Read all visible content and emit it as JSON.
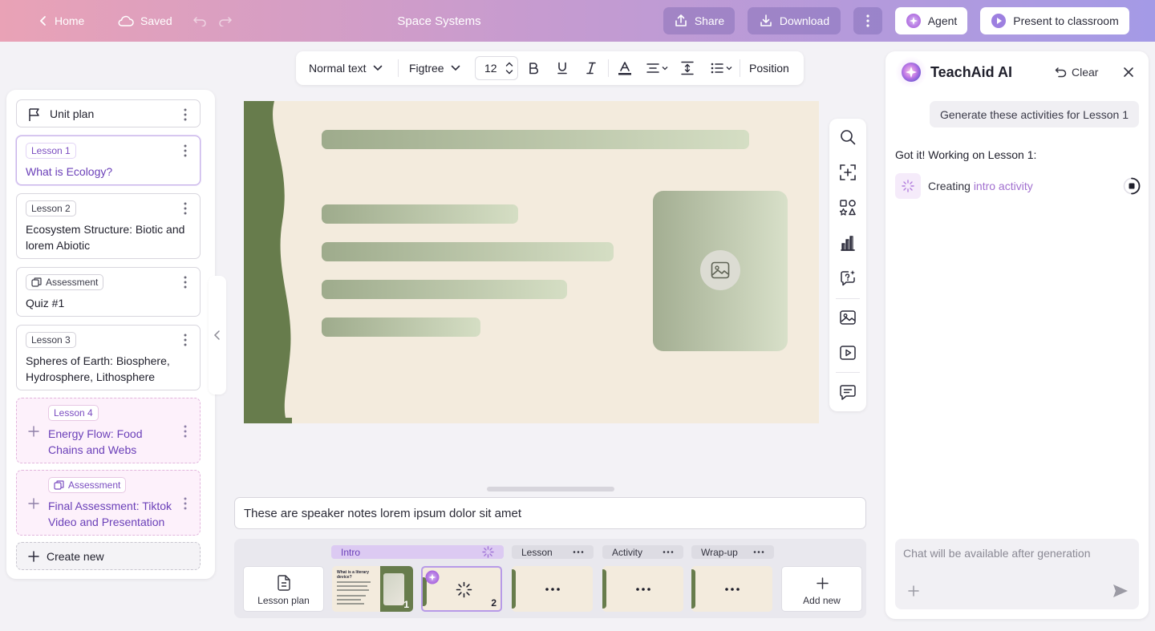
{
  "topbar": {
    "home_label": "Home",
    "saved_label": "Saved",
    "title": "Space Systems",
    "share_label": "Share",
    "download_label": "Download",
    "agent_label": "Agent",
    "present_label": "Present to classroom"
  },
  "sidebar": {
    "unit_plan_label": "Unit plan",
    "items": [
      {
        "tag": "Lesson 1",
        "title": "What is Ecology?"
      },
      {
        "tag": "Lesson 2",
        "title_line1": "Ecosystem Structure: Biotic and",
        "title_line2": "lorem Abiotic"
      },
      {
        "tag": "Assessment",
        "title": "Quiz #1"
      },
      {
        "tag": "Lesson 3",
        "title_line1": "Spheres of Earth: Biosphere,",
        "title_line2": "Hydrosphere, Lithosphere"
      },
      {
        "tag": "Lesson 4",
        "title_line1": "Energy Flow: Food",
        "title_line2": "Chains and Webs"
      },
      {
        "tag": "Assessment",
        "title_line1": "Final Assessment: Tiktok",
        "title_line2": "Video and Presentation"
      }
    ],
    "create_new_label": "Create new"
  },
  "format_toolbar": {
    "style_label": "Normal text",
    "font_label": "Figtree",
    "font_size": "12",
    "position_label": "Position"
  },
  "speaker_notes": "These are speaker notes lorem ipsum dolor sit amet",
  "filmstrip": {
    "sections": [
      {
        "label": "Intro"
      },
      {
        "label": "Lesson"
      },
      {
        "label": "Activity"
      },
      {
        "label": "Wrap-up"
      }
    ],
    "lesson_plan_label": "Lesson plan",
    "thumb1_title": "What is a literary device?",
    "slide_numbers": [
      "1",
      "2"
    ],
    "add_new_label": "Add new"
  },
  "ai_panel": {
    "title": "TeachAid AI",
    "clear_label": "Clear",
    "user_message": "Generate these activities for Lesson 1",
    "reply": "Got it! Working on Lesson 1:",
    "status_prefix": "Creating ",
    "status_accent": "intro activity",
    "chat_placeholder": "Chat will be available after generation"
  },
  "colors": {
    "accent_purple": "#6a3fb8",
    "slide_green": "#677c4c",
    "slide_background": "#f3ebdd"
  }
}
